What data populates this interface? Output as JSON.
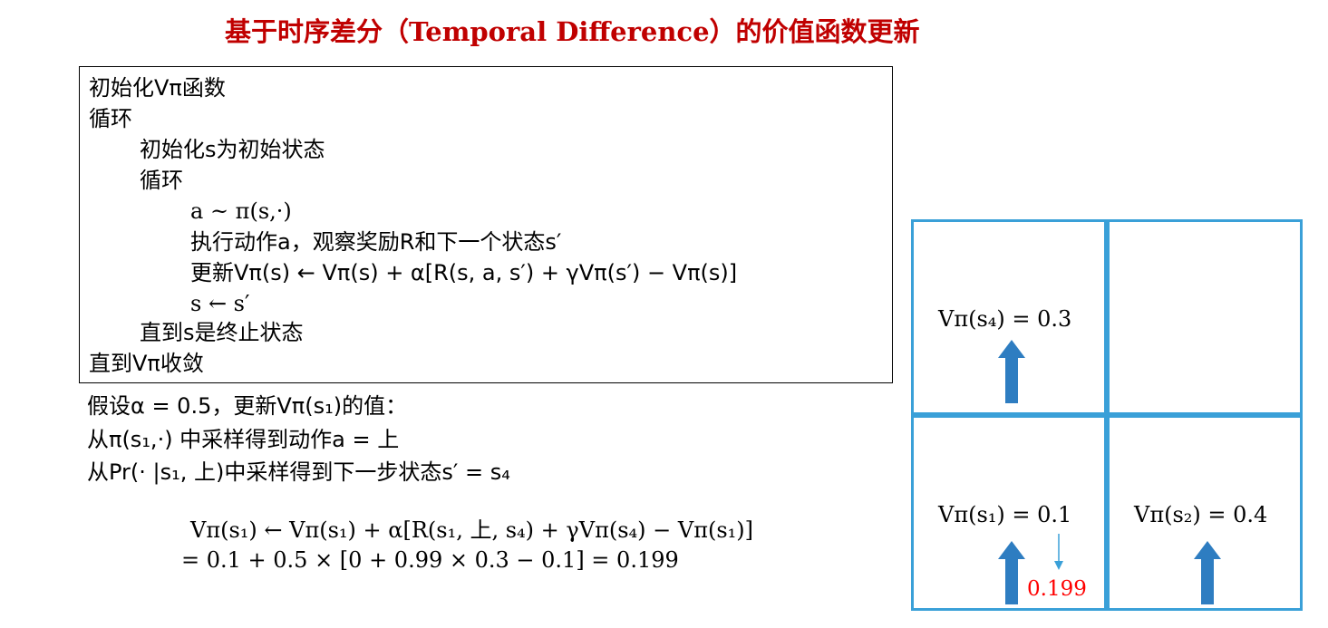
{
  "title": "基于时序差分（Temporal Difference）的价值函数更新",
  "algorithm": {
    "lines": [
      "初始化Vπ函数",
      "循环",
      "初始化s为初始状态",
      "循环",
      "a ~ π(s,·)",
      "执行动作a，观察奖励R和下一个状态s′",
      "更新Vπ(s) ← Vπ(s) + α[R(s, a, s′) + γVπ(s′) − Vπ(s)]",
      "s ← s′",
      "直到s是终止状态",
      "直到Vπ收敛"
    ]
  },
  "example": {
    "lines": [
      "假设α = 0.5，更新Vπ(s₁)的值：",
      "从π(s₁,·) 中采样得到动作a = 上",
      "从Pr(· |s₁, 上)中采样得到下一步状态s′ = s₄"
    ],
    "formula_line1": "Vπ(s₁) ← Vπ(s₁) + α[R(s₁, 上, s₄) + γVπ(s₄) − Vπ(s₁)]",
    "formula_line2": "= 0.1 + 0.5 × [0 + 0.99 × 0.3 − 0.1] = 0.199"
  },
  "grid": {
    "s4_label": "Vπ(s₄) = 0.3",
    "s1_label": "Vπ(s₁) = 0.1",
    "s2_label": "Vπ(s₂) = 0.4",
    "s1_updated": "0.199",
    "border_color": "#3aa0d8",
    "arrow_color": "#2e7dc1",
    "updated_color": "#ff0000"
  }
}
